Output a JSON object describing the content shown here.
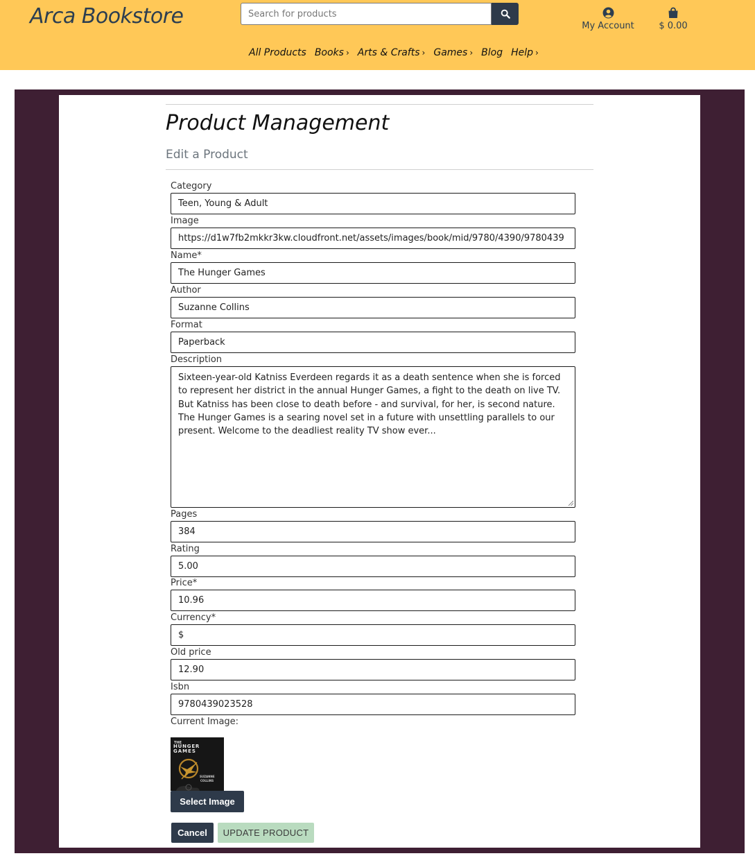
{
  "header": {
    "logo": "Arca Bookstore",
    "search_placeholder": "Search for products",
    "account_label": "My Account",
    "bag_total": "$ 0.00"
  },
  "nav": {
    "items": [
      "All Products",
      "Books",
      "Arts & Crafts",
      "Games",
      "Blog",
      "Help"
    ]
  },
  "page": {
    "title": "Product Management",
    "subtitle": "Edit a Product"
  },
  "form": {
    "category": {
      "label": "Category",
      "value": "Teen, Young & Adult"
    },
    "image": {
      "label": "Image",
      "value": "https://d1w7fb2mkkr3kw.cloudfront.net/assets/images/book/mid/9780/4390/9780439"
    },
    "name": {
      "label": "Name*",
      "value": "The Hunger Games"
    },
    "author": {
      "label": "Author",
      "value": "Suzanne Collins"
    },
    "format": {
      "label": "Format",
      "value": "Paperback"
    },
    "description": {
      "label": "Description",
      "value": "Sixteen-year-old Katniss Everdeen regards it as a death sentence when she is forced to represent her district in the annual Hunger Games, a fight to the death on live TV. But Katniss has been close to death before - and survival, for her, is second nature. The Hunger Games is a searing novel set in a future with unsettling parallels to our present. Welcome to the deadliest reality TV show ever..."
    },
    "pages": {
      "label": "Pages",
      "value": "384"
    },
    "rating": {
      "label": "Rating",
      "value": "5.00"
    },
    "price": {
      "label": "Price*",
      "value": "10.96"
    },
    "currency": {
      "label": "Currency*",
      "value": "$"
    },
    "old_price": {
      "label": "Old price",
      "value": "12.90"
    },
    "isbn": {
      "label": "Isbn",
      "value": "9780439023528"
    },
    "current_image_label": "Current Image:",
    "cover": {
      "line1": "THE",
      "line2": "HUNGER",
      "line3": "GAMES",
      "author1": "SUZANNE",
      "author2": "COLLINS"
    },
    "select_image_label": "Select Image",
    "cancel_label": "Cancel",
    "update_label": "UPDATE PRODUCT"
  },
  "colors": {
    "header_bg": "#ffc857",
    "frame_bg": "#3e1f33",
    "primary_button": "#2e3a4a",
    "update_button": "#b9dbbf"
  }
}
